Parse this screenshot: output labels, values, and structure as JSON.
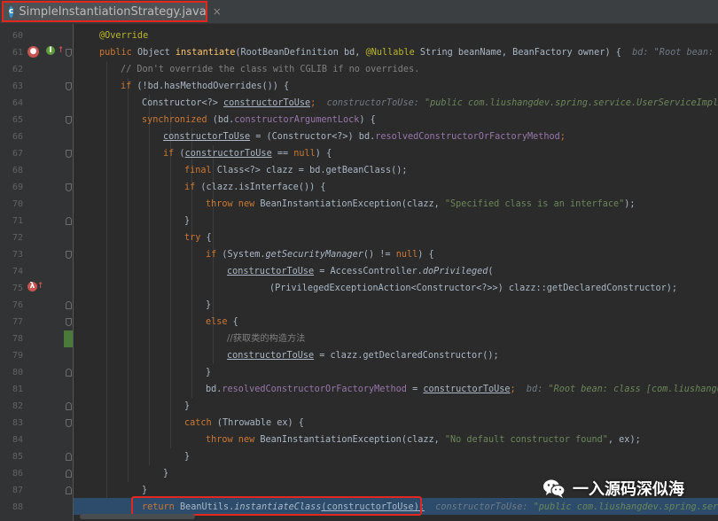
{
  "tab": {
    "title": "SimpleInstantiationStrategy.java",
    "icon": "c-class-icon",
    "close": "×"
  },
  "line_numbers": [
    "60",
    "61",
    "62",
    "63",
    "64",
    "65",
    "66",
    "67",
    "68",
    "69",
    "70",
    "71",
    "72",
    "73",
    "74",
    "75",
    "76",
    "77",
    "78",
    "79",
    "80",
    "81",
    "82",
    "83",
    "84",
    "85",
    "86",
    "87",
    "88"
  ],
  "code": {
    "l60": "@Override",
    "l61": {
      "public": "public",
      "object": "Object",
      "method": "instantiate",
      "params": "(RootBeanDefinition bd, ",
      "nullable": "@Nullable",
      "rest": " String beanName, BeanFactory owner) {",
      "hint": "bd: \"Root bean: cl"
    },
    "l62": "// Don't override the class with CGLIB if no overrides.",
    "l63": {
      "if": "if",
      "rest": " (!bd.hasMethodOverrides()) {"
    },
    "l64": {
      "type": "Constructor<?> ",
      "var": "constructorToUse",
      "semi": ";",
      "hint": "constructorToUse: ",
      "hintstr": "\"public com.liushangdev.spring.service.UserServiceImpl()\""
    },
    "l65": {
      "sync": "synchronized",
      "open": " (bd.",
      "field": "constructorArgumentLock",
      "close": ") {"
    },
    "l66": {
      "var": "constructorToUse",
      "mid": " = (Constructor<?>) bd.",
      "field": "resolvedConstructorOrFactoryMethod",
      "end": ";"
    },
    "l67": {
      "if": "if",
      "open": " (",
      "var": "constructorToUse",
      "eq": " == ",
      "null": "null",
      "close": ") {"
    },
    "l68": {
      "final": "final",
      "rest": " Class<?> clazz = bd.getBeanClass();"
    },
    "l69": {
      "if": "if",
      "rest": " (clazz.isInterface()) {"
    },
    "l70": {
      "throw": "throw",
      "new": " new",
      "mid": " BeanInstantiationException(clazz, ",
      "str": "\"Specified class is an interface\"",
      "end": ");"
    },
    "l71": "}",
    "l72": {
      "try": "try",
      "rest": " {"
    },
    "l73": {
      "if": "if",
      "open": " (System.",
      "method": "getSecurityManager",
      "mid": "() != ",
      "null": "null",
      "close": ") {"
    },
    "l74": {
      "var": "constructorToUse",
      "mid": " = AccessController.",
      "method": "doPrivileged",
      "end": "("
    },
    "l75": "(PrivilegedExceptionAction<Constructor<?>>) clazz::getDeclaredConstructor);",
    "l76": "}",
    "l77": {
      "else": "else",
      "rest": " {"
    },
    "l78": "//获取类的构造方法",
    "l79": {
      "var": "constructorToUse",
      "rest": " = clazz.getDeclaredConstructor();"
    },
    "l80": "}",
    "l81": {
      "pre": "bd.",
      "field": "resolvedConstructorOrFactoryMethod",
      "eq": " = ",
      "var": "constructorToUse",
      "semi": ";",
      "hint": "bd: ",
      "hintstr": "\"Root bean: class [com.liushangdev"
    },
    "l82": "}",
    "l83": {
      "catch": "catch",
      "rest": " (Throwable ex) {"
    },
    "l84": {
      "throw": "throw",
      "new": " new",
      "mid": " BeanInstantiationException(clazz, ",
      "str": "\"No default constructor found\"",
      "end": ", ex);"
    },
    "l85": "}",
    "l86": "}",
    "l87": "}",
    "l88": {
      "return": "return",
      "pre": " BeanUtils.",
      "method": "instantiateClass",
      "args": "(constructorToUse);",
      "hint": "constructorToUse: ",
      "hintstr": "\"public com.liushangdev.spring.servi"
    }
  },
  "watermark": {
    "text": "一入源码深似海",
    "icon": "wechat-icon"
  },
  "colors": {
    "background": "#2b2b2b",
    "gutter": "#313335",
    "keyword": "#cc7832",
    "annotation": "#bbb529",
    "field": "#9876aa",
    "string": "#6a8759",
    "highlight_box": "#e2271f",
    "current_line": "#2d4b6b"
  }
}
